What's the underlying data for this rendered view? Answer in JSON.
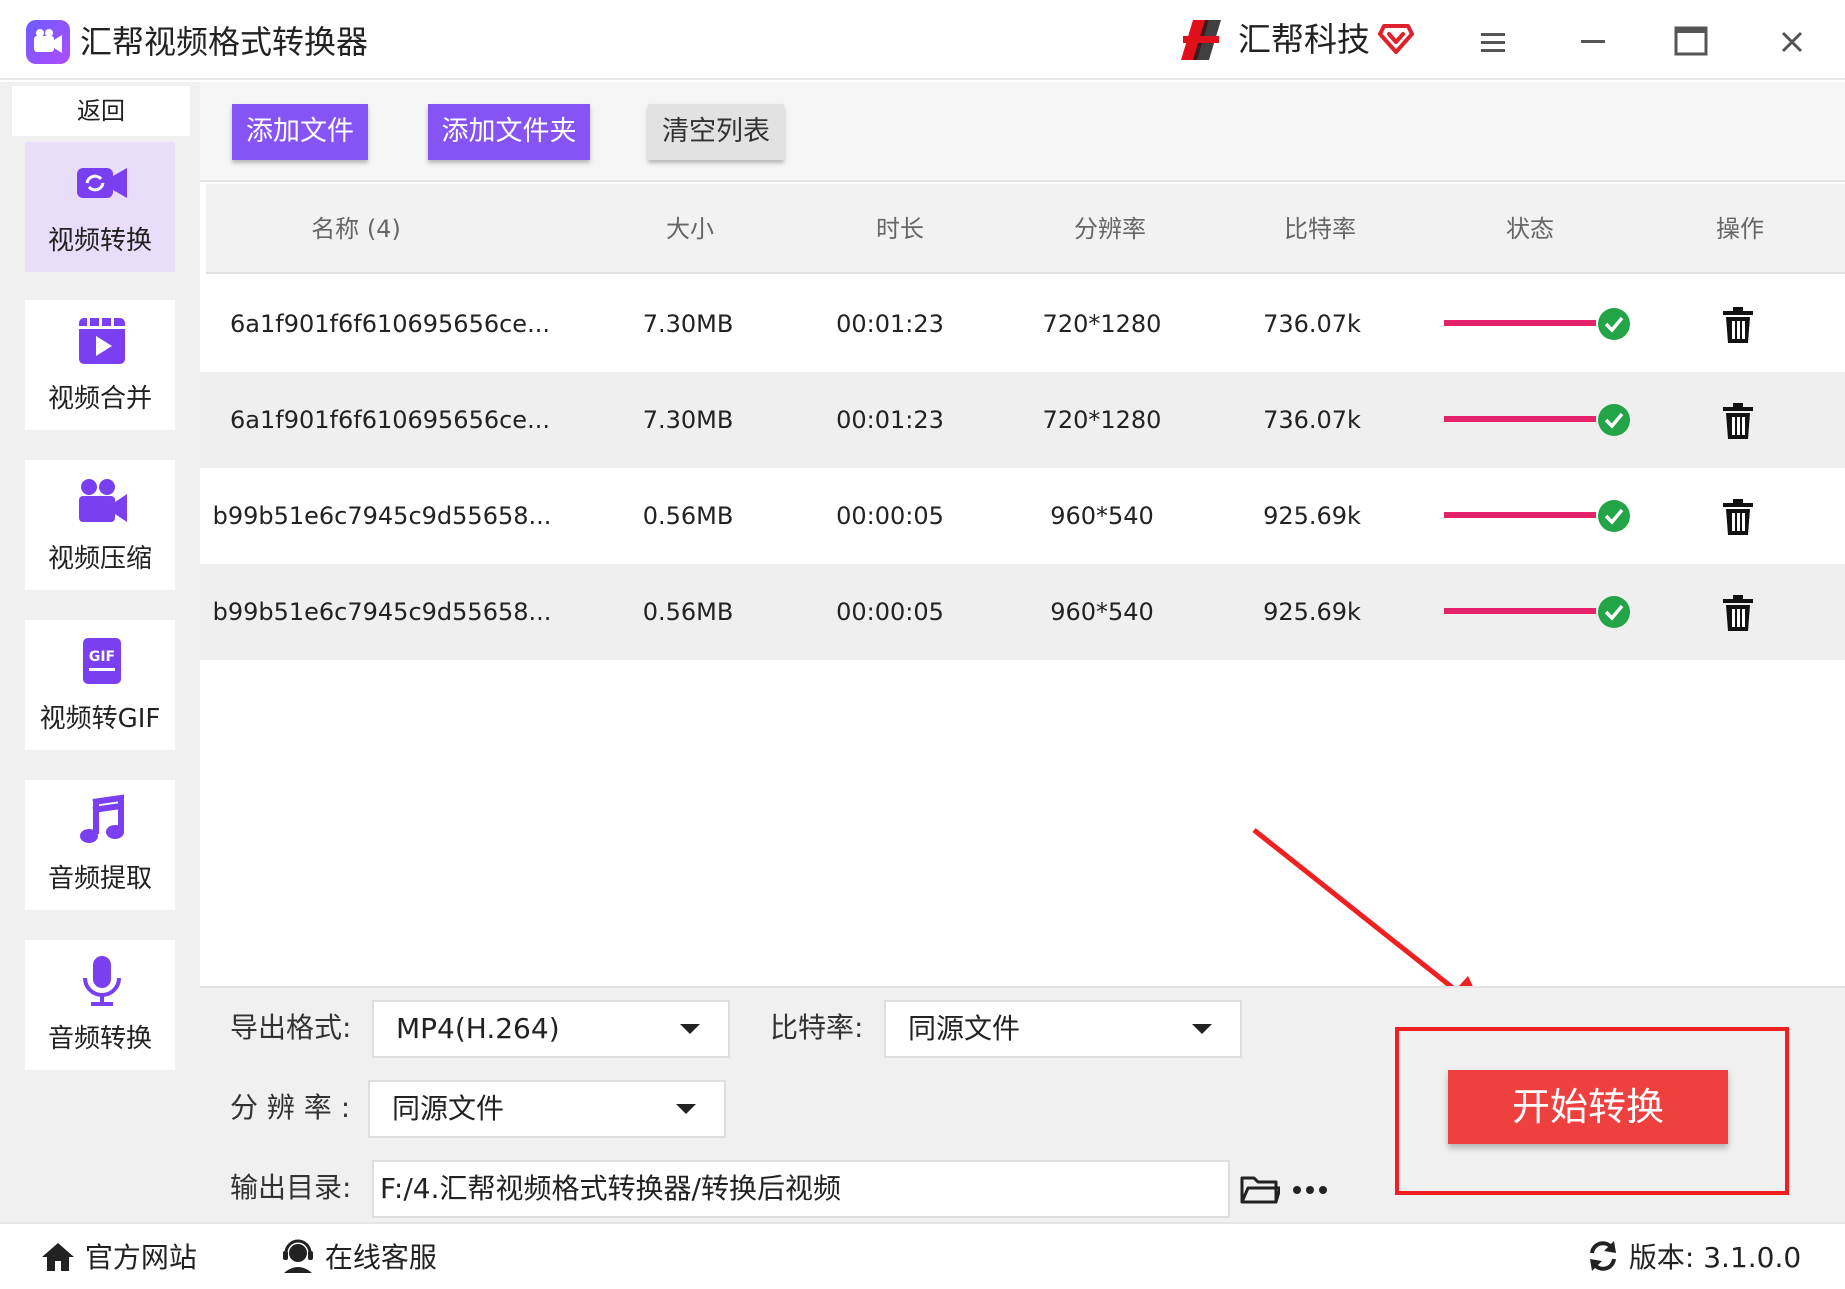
{
  "window": {
    "title": "汇帮视频格式转换器",
    "brand": "汇帮科技",
    "icons": [
      "menu-icon",
      "minimize-icon",
      "maximize-icon",
      "close-icon"
    ]
  },
  "sidebar": {
    "back_label": "返回",
    "items": [
      {
        "label": "视频转换",
        "icon": "video-convert-icon",
        "active": true
      },
      {
        "label": "视频合并",
        "icon": "video-merge-icon",
        "active": false
      },
      {
        "label": "视频压缩",
        "icon": "video-compress-icon",
        "active": false
      },
      {
        "label": "视频转GIF",
        "icon": "gif-icon",
        "active": false
      },
      {
        "label": "音频提取",
        "icon": "music-icon",
        "active": false
      },
      {
        "label": "音频转换",
        "icon": "microphone-icon",
        "active": false
      }
    ]
  },
  "toolbar": {
    "add_file": "添加文件",
    "add_folder": "添加文件夹",
    "clear_list": "清空列表"
  },
  "table": {
    "headers": [
      "名称 (4)",
      "大小",
      "时长",
      "分辨率",
      "比特率",
      "状态",
      "操作"
    ],
    "rows": [
      {
        "name": "6a1f901f6f610695656ce...",
        "size": "7.30MB",
        "duration": "00:01:23",
        "resolution": "720*1280",
        "bitrate": "736.07k",
        "progress": 1.0
      },
      {
        "name": "6a1f901f6f610695656ce...",
        "size": "7.30MB",
        "duration": "00:01:23",
        "resolution": "720*1280",
        "bitrate": "736.07k",
        "progress": 1.0
      },
      {
        "name": "b99b51e6c7945c9d55658...",
        "size": "0.56MB",
        "duration": "00:00:05",
        "resolution": "960*540",
        "bitrate": "925.69k",
        "progress": 1.0
      },
      {
        "name": "b99b51e6c7945c9d55658...",
        "size": "0.56MB",
        "duration": "00:00:05",
        "resolution": "960*540",
        "bitrate": "925.69k",
        "progress": 1.0
      }
    ]
  },
  "settings": {
    "format_label": "导出格式:",
    "format_value": "MP4(H.264)",
    "bitrate_label": "比特率:",
    "bitrate_value": "同源文件",
    "resolution_label": "分 辨 率 :",
    "resolution_value": "同源文件",
    "output_label": "输出目录:",
    "output_value": "F:/4.汇帮视频格式转换器/转换后视频",
    "start_label": "开始转换"
  },
  "statusbar": {
    "website": "官方网站",
    "support": "在线客服",
    "version": "版本:  3.1.0.0"
  },
  "colors": {
    "accent": "#8654f5",
    "start_button": "#ef4040",
    "progress": "#e5236b",
    "done": "#22a447",
    "annotation": "#f02020"
  }
}
